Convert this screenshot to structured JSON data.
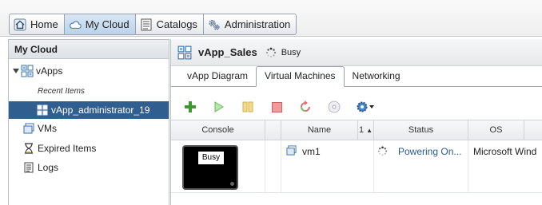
{
  "nav": {
    "home": "Home",
    "mycloud": "My Cloud",
    "catalogs": "Catalogs",
    "administration": "Administration"
  },
  "sidebar": {
    "title": "My Cloud",
    "vapps": "vApps",
    "recent_items": "Recent Items",
    "recent_vapp": "vApp_administrator_19",
    "vms": "VMs",
    "expired": "Expired Items",
    "logs": "Logs"
  },
  "header": {
    "title": "vApp_Sales",
    "status": "Busy"
  },
  "tabs": [
    {
      "label": "vApp Diagram"
    },
    {
      "label": "Virtual Machines"
    },
    {
      "label": "Networking"
    }
  ],
  "grid": {
    "columns": {
      "console": "Console",
      "name": "Name",
      "sort_num": "1",
      "status": "Status",
      "os": "OS"
    },
    "rows": [
      {
        "console_label": "Busy",
        "name": "vm1",
        "status": "Powering On...",
        "os": "Microsoft Wind"
      }
    ]
  },
  "colors": {
    "accent": "#2f5e8f",
    "status_link": "#2a5a8c"
  }
}
